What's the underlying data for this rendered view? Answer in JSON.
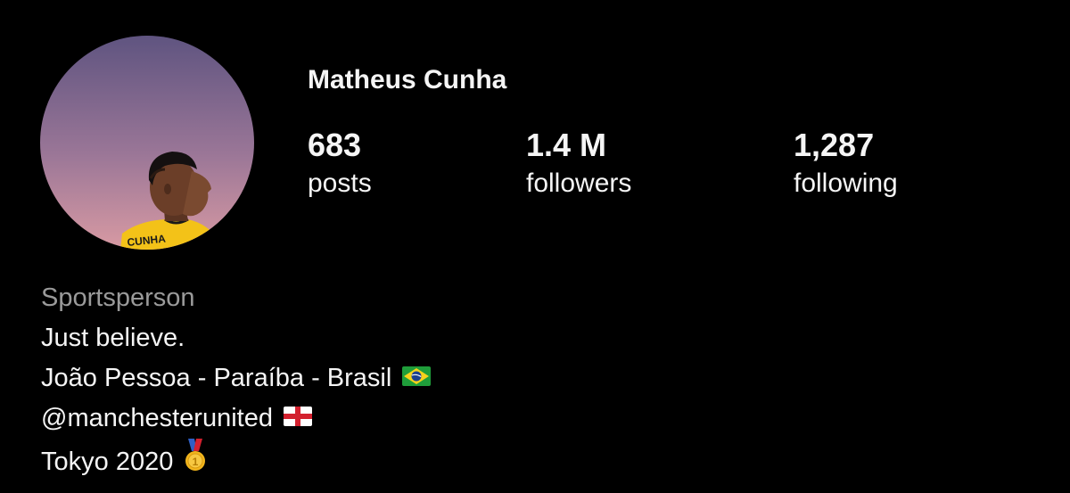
{
  "profile": {
    "name": "Matheus Cunha",
    "avatar_shirt_text": "CUNHA"
  },
  "stats": {
    "posts": {
      "value": "683",
      "label": "posts"
    },
    "followers": {
      "value": "1.4 M",
      "label": "followers"
    },
    "following": {
      "value": "1,287",
      "label": "following"
    }
  },
  "bio": {
    "category": "Sportsperson",
    "line1": "Just believe.",
    "line2": "João Pessoa - Paraíba - Brasil",
    "line3": "@manchesterunited",
    "line4": "Tokyo 2020"
  },
  "icons": {
    "brazil_flag": "brazil-flag-icon",
    "england_flag": "england-flag-icon",
    "gold_medal": "gold-medal-icon"
  },
  "colors": {
    "background": "#000000",
    "text": "#f5f5f5",
    "category_text": "#9a9a9a",
    "avatar_gradient_top": "#5f5480",
    "avatar_gradient_bottom": "#d89aa3",
    "shirt_yellow": "#f3c218"
  }
}
